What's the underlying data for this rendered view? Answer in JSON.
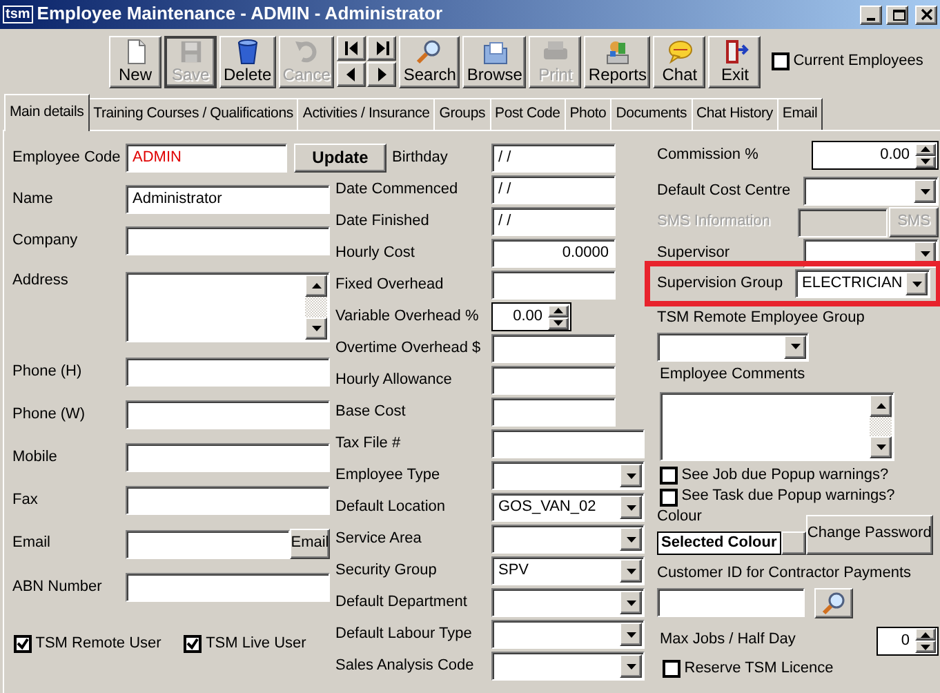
{
  "window": {
    "logo": "tsm",
    "title": "Employee Maintenance - ADMIN - Administrator"
  },
  "toolbar": [
    {
      "kind": "new",
      "label": "New",
      "disabled": false,
      "focused": false
    },
    {
      "kind": "save",
      "label": "Save",
      "disabled": true,
      "focused": true
    },
    {
      "kind": "delete",
      "label": "Delete",
      "disabled": false,
      "focused": false
    },
    {
      "kind": "cancel",
      "label": "Cance",
      "disabled": true,
      "focused": false
    },
    {
      "kind": "nav"
    },
    {
      "kind": "search",
      "label": "Search",
      "disabled": false,
      "focused": false
    },
    {
      "kind": "browse",
      "label": "Browse",
      "disabled": false,
      "focused": false
    },
    {
      "kind": "print",
      "label": "Print",
      "disabled": true,
      "focused": false
    },
    {
      "kind": "reports",
      "label": "Reports",
      "disabled": false,
      "focused": false
    },
    {
      "kind": "chat",
      "label": "Chat",
      "disabled": false,
      "focused": false
    },
    {
      "kind": "exit",
      "label": "Exit",
      "disabled": false,
      "focused": false
    }
  ],
  "current_employees": {
    "label": "Current Employees",
    "checked": false
  },
  "tabs": [
    {
      "label": "Main details",
      "selected": true
    },
    {
      "label": "Training Courses / Qualifications",
      "selected": false
    },
    {
      "label": "Activities / Insurance",
      "selected": false
    },
    {
      "label": "Groups",
      "selected": false
    },
    {
      "label": "Post Code",
      "selected": false
    },
    {
      "label": "Photo",
      "selected": false
    },
    {
      "label": "Documents",
      "selected": false
    },
    {
      "label": "Chat History",
      "selected": false
    },
    {
      "label": "Email",
      "selected": false
    }
  ],
  "left": [
    {
      "kind": "text",
      "label": "Employee Code",
      "value": "ADMIN",
      "invalid": true,
      "button": "Update"
    },
    {
      "kind": "text",
      "label": "Name",
      "value": "Administrator"
    },
    {
      "kind": "text",
      "label": "Company"
    },
    {
      "kind": "textarea",
      "label": "Address"
    },
    {
      "kind": "text",
      "label": "Phone (H)"
    },
    {
      "kind": "text",
      "label": "Phone (W)"
    },
    {
      "kind": "text",
      "label": "Mobile"
    },
    {
      "kind": "text",
      "label": "Fax"
    },
    {
      "kind": "text",
      "label": "Email",
      "button": "Email"
    },
    {
      "kind": "text",
      "label": "ABN Number"
    }
  ],
  "left_checks": [
    {
      "label": "TSM Remote User",
      "checked": true
    },
    {
      "label": "TSM Live User",
      "checked": true
    }
  ],
  "middle": [
    {
      "kind": "text",
      "label": "Birthday",
      "value": "/ /"
    },
    {
      "kind": "text",
      "label": "Date Commenced",
      "value": "/ /"
    },
    {
      "kind": "text",
      "label": "Date Finished",
      "value": "/ /"
    },
    {
      "kind": "number",
      "label": "Hourly Cost",
      "value": "0.0000"
    },
    {
      "kind": "text",
      "label": "Fixed Overhead"
    },
    {
      "kind": "spin",
      "label": "Variable Overhead %",
      "value": "0.00"
    },
    {
      "kind": "text",
      "label": "Overtime Overhead $"
    },
    {
      "kind": "text",
      "label": "Hourly Allowance"
    },
    {
      "kind": "text",
      "label": "Base Cost"
    },
    {
      "kind": "wide",
      "label": "Tax File #"
    },
    {
      "kind": "combo",
      "label": "Employee Type"
    },
    {
      "kind": "combo",
      "label": "Default Location",
      "value": "GOS_VAN_02"
    },
    {
      "kind": "combo",
      "label": "Service Area"
    },
    {
      "kind": "combo",
      "label": "Security Group",
      "value": "SPV"
    },
    {
      "kind": "combo",
      "label": "Default Department"
    },
    {
      "kind": "combo",
      "label": "Default Labour Type"
    },
    {
      "kind": "combo",
      "label": "Sales Analysis Code"
    }
  ],
  "right": {
    "commission": {
      "label": "Commission %",
      "value": "0.00"
    },
    "cost_centre": {
      "label": "Default Cost Centre"
    },
    "sms": {
      "label": "SMS Information",
      "button": "SMS",
      "disabled": true
    },
    "supervisor": {
      "label": "Supervisor"
    },
    "supervision_group": {
      "label": "Supervision Group",
      "value": "ELECTRICIAN",
      "highlighted": true
    },
    "remote_group": {
      "label": "TSM Remote Employee Group"
    },
    "comments": {
      "label": "Employee Comments"
    },
    "checks": [
      {
        "label": "See Job due Popup warnings?",
        "checked": false
      },
      {
        "label": "See Task due Popup warnings?",
        "checked": false
      }
    ],
    "colour": {
      "label": "Colour",
      "swatch": "Selected Colour"
    },
    "change_password": "Change Password",
    "customer_id": {
      "label": "Customer ID for Contractor Payments"
    },
    "max_jobs": {
      "label": "Max Jobs / Half Day",
      "value": "0"
    },
    "reserve": {
      "label": "Reserve TSM Licence",
      "checked": false
    }
  }
}
